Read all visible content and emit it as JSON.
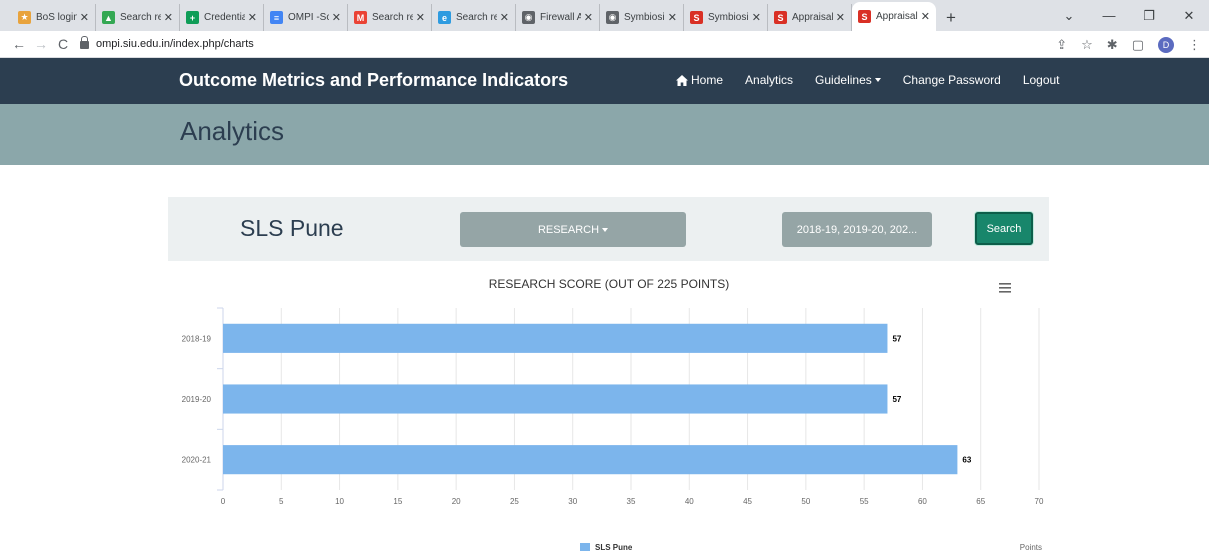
{
  "browser": {
    "tabs": [
      {
        "title": "BoS login",
        "fav_color": "#e8a33d",
        "fav_glyph": "★"
      },
      {
        "title": "Search res",
        "fav_color": "#34a853",
        "fav_glyph": "▲"
      },
      {
        "title": "Credential",
        "fav_color": "#0f9d58",
        "fav_glyph": "+"
      },
      {
        "title": "OMPI -Sc",
        "fav_color": "#4285f4",
        "fav_glyph": "≡"
      },
      {
        "title": "Search res",
        "fav_color": "#ea4335",
        "fav_glyph": "M"
      },
      {
        "title": "Search res",
        "fav_color": "#2e9be0",
        "fav_glyph": "e"
      },
      {
        "title": "Firewall Au",
        "fav_color": "#5f6368",
        "fav_glyph": "◉"
      },
      {
        "title": "Symbiosis",
        "fav_color": "#5f6368",
        "fav_glyph": "◉"
      },
      {
        "title": "Symbiosis",
        "fav_color": "#d93025",
        "fav_glyph": "S"
      },
      {
        "title": "Appraisal",
        "fav_color": "#d93025",
        "fav_glyph": "S"
      },
      {
        "title": "Appraisal",
        "fav_color": "#d93025",
        "fav_glyph": "S",
        "active": true
      }
    ],
    "url": "ompi.siu.edu.in/index.php/charts",
    "profile_initial": "D"
  },
  "site": {
    "brand": "Outcome Metrics and Performance Indicators",
    "nav": {
      "home": "Home",
      "analytics": "Analytics",
      "guidelines": "Guidelines",
      "change_password": "Change Password",
      "logout": "Logout"
    },
    "page_title": "Analytics"
  },
  "filters": {
    "campus": "SLS Pune",
    "category": "RESEARCH",
    "years": "2018-19, 2019-20, 202...",
    "search_label": "Search"
  },
  "colors": {
    "navbar": "#2c3e50",
    "header_band": "#8ba7aa",
    "bar": "#7cb5ec",
    "search_button": "#18866b"
  },
  "chart_data": {
    "type": "bar",
    "orientation": "horizontal",
    "title": "RESEARCH SCORE (OUT OF 225 POINTS)",
    "categories": [
      "2018-19",
      "2019-20",
      "2020-21"
    ],
    "series": [
      {
        "name": "SLS Pune",
        "values": [
          57,
          57,
          63
        ]
      }
    ],
    "xlabel": "Points",
    "xlim": [
      0,
      70
    ],
    "xticks": [
      0,
      5,
      10,
      15,
      20,
      25,
      30,
      35,
      40,
      45,
      50,
      55,
      60,
      65,
      70
    ],
    "grid": true,
    "legend": "bottom-center",
    "data_labels": true
  }
}
